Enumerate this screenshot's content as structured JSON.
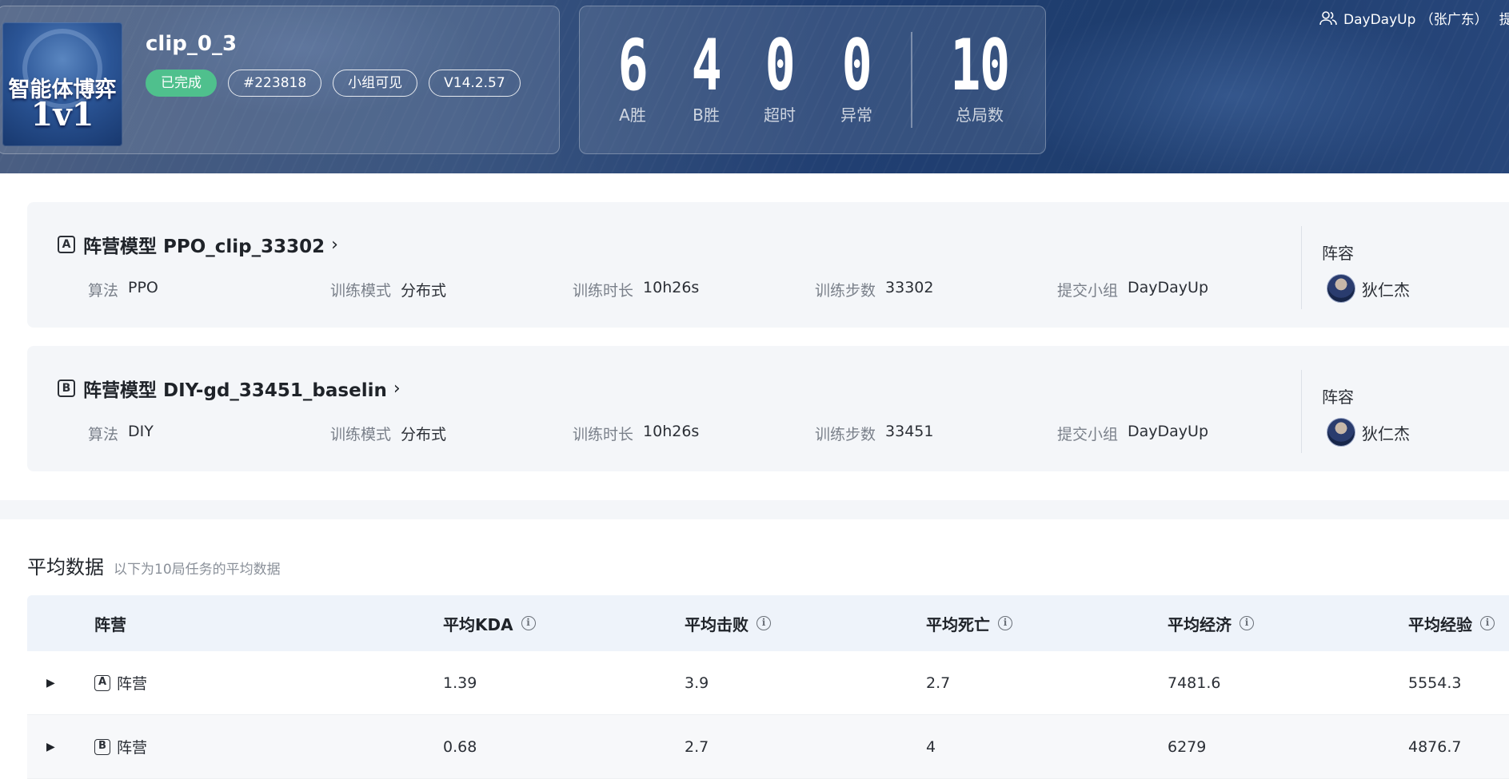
{
  "header": {
    "logo_text_line1": "智能体博弈",
    "logo_text_line2": "1v1",
    "task_name": "clip_0_3",
    "tags": {
      "status": "已完成",
      "id": "#223818",
      "visibility": "小组可见",
      "version": "V14.2.57"
    },
    "scores": {
      "a_wins": {
        "value": "6",
        "label": "A胜"
      },
      "b_wins": {
        "value": "4",
        "label": "B胜"
      },
      "timeout": {
        "value": "0",
        "label": "超时"
      },
      "error": {
        "value": "0",
        "label": "异常"
      },
      "total": {
        "value": "10",
        "label": "总局数"
      }
    },
    "user": {
      "name": "DayDayUp （张广东）",
      "submit_label": "提交"
    }
  },
  "models": [
    {
      "badge": "A",
      "title": "阵营模型 PPO_clip_33302",
      "params": [
        {
          "k": "算法",
          "v": "PPO"
        },
        {
          "k": "训练模式",
          "v": "分布式"
        },
        {
          "k": "训练时长",
          "v": "10h26s"
        },
        {
          "k": "训练步数",
          "v": "33302"
        },
        {
          "k": "提交小组",
          "v": "DayDayUp"
        }
      ],
      "lineup_title": "阵容",
      "hero": "狄仁杰"
    },
    {
      "badge": "B",
      "title": "阵营模型 DIY-gd_33451_baselin",
      "params": [
        {
          "k": "算法",
          "v": "DIY"
        },
        {
          "k": "训练模式",
          "v": "分布式"
        },
        {
          "k": "训练时长",
          "v": "10h26s"
        },
        {
          "k": "训练步数",
          "v": "33451"
        },
        {
          "k": "提交小组",
          "v": "DayDayUp"
        }
      ],
      "lineup_title": "阵容",
      "hero": "狄仁杰"
    }
  ],
  "average": {
    "title": "平均数据",
    "subtitle": "以下为10局任务的平均数据",
    "columns": [
      "阵营",
      "平均KDA",
      "平均击败",
      "平均死亡",
      "平均经济",
      "平均经验"
    ],
    "rows": [
      {
        "badge": "A",
        "camp": "阵营",
        "kda": "1.39",
        "kills": "3.9",
        "deaths": "2.7",
        "gold": "7481.6",
        "exp": "5554.3"
      },
      {
        "badge": "B",
        "camp": "阵营",
        "kda": "0.68",
        "kills": "2.7",
        "deaths": "4",
        "gold": "6279",
        "exp": "4876.7"
      }
    ]
  },
  "colors": {
    "status_done": "#4fc08d",
    "banner_dark": "#1e3d6e",
    "card_bg": "#f4f6f9",
    "table_header_bg": "#eef3fa"
  },
  "icons": {
    "user": "user-group-icon",
    "info": "info-circle-icon",
    "expand": "caret-right-icon",
    "chevron": "chevron-right-icon"
  }
}
